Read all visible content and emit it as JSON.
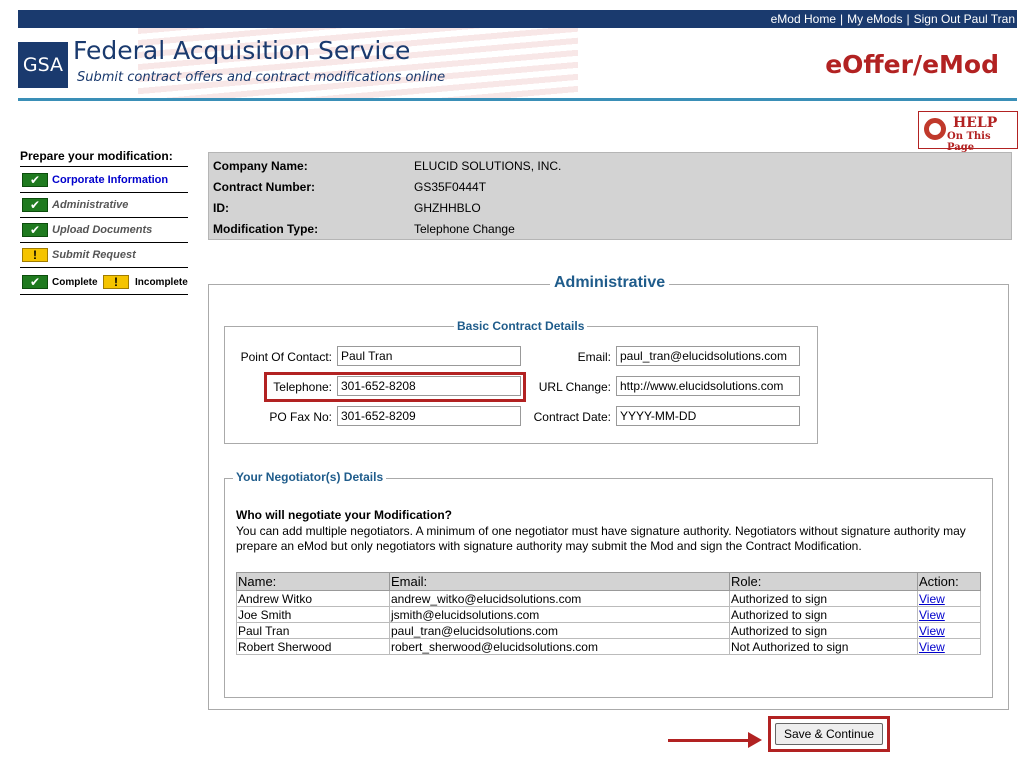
{
  "top_nav": {
    "links": [
      "eMod Home",
      "My eMods",
      "Sign Out Paul Tran"
    ],
    "separator": "|"
  },
  "header": {
    "logo_text": "GSA",
    "title": "Federal Acquisition Service",
    "subtitle": "Submit contract offers and contract modifications online",
    "product": "eOffer/eMod"
  },
  "help": {
    "line1": "HELP",
    "line2": "On This Page"
  },
  "sidebar": {
    "title": "Prepare your modification:",
    "steps": [
      {
        "label": "Corporate Information",
        "status": "complete",
        "color": "#0000cc",
        "bold": true,
        "italic": false
      },
      {
        "label": "Administrative",
        "status": "complete",
        "color": "#555555",
        "bold": true,
        "italic": true
      },
      {
        "label": "Upload Documents",
        "status": "complete",
        "color": "#555555",
        "bold": true,
        "italic": true
      },
      {
        "label": "Submit Request",
        "status": "incomplete",
        "color": "#555555",
        "bold": true,
        "italic": true
      }
    ],
    "legend": {
      "complete": "Complete",
      "incomplete": "Incomplete"
    }
  },
  "info": {
    "rows": [
      {
        "key": "Company Name:",
        "value": "ELUCID SOLUTIONS, INC."
      },
      {
        "key": "Contract Number:",
        "value": "GS35F0444T"
      },
      {
        "key": "ID:",
        "value": "GHZHHBLO"
      },
      {
        "key": "Modification Type:",
        "value": "Telephone Change"
      }
    ]
  },
  "admin": {
    "title": "Administrative",
    "basic": {
      "title": "Basic Contract Details",
      "point_of_contact_label": "Point Of Contact:",
      "point_of_contact": "Paul Tran",
      "telephone_label": "Telephone:",
      "telephone": "301-652-8208",
      "po_fax_label": "PO Fax No:",
      "po_fax": "301-652-8209",
      "email_label": "Email:",
      "email": "paul_tran@elucidsolutions.com",
      "url_label": "URL Change:",
      "url": "http://www.elucidsolutions.com",
      "contract_date_label": "Contract Date:",
      "contract_date": "YYYY-MM-DD"
    },
    "negotiators": {
      "title": "Your Negotiator(s) Details",
      "question": "Who will negotiate your Modification?",
      "description": "You can add multiple negotiators. A minimum of one negotiator must have signature authority. Negotiators without signature authority may prepare an eMod but only negotiators with signature authority may submit the Mod and sign the Contract Modification.",
      "columns": [
        "Name:",
        "Email:",
        "Role:",
        "Action:"
      ],
      "rows": [
        {
          "name": "Andrew Witko",
          "email": "andrew_witko@elucidsolutions.com",
          "role": "Authorized to sign",
          "action": "View"
        },
        {
          "name": "Joe Smith",
          "email": "jsmith@elucidsolutions.com",
          "role": "Authorized to sign",
          "action": "View"
        },
        {
          "name": "Paul Tran",
          "email": "paul_tran@elucidsolutions.com",
          "role": "Authorized to sign",
          "action": "View"
        },
        {
          "name": "Robert Sherwood",
          "email": "robert_sherwood@elucidsolutions.com",
          "role": "Not Authorized to sign",
          "action": "View"
        }
      ]
    }
  },
  "save_button": "Save & Continue",
  "colors": {
    "nav_bg": "#1a3a6e",
    "accent": "#b22222",
    "section_title": "#1f5c8b",
    "complete": "#1f7a1f",
    "incomplete": "#f5c400"
  }
}
